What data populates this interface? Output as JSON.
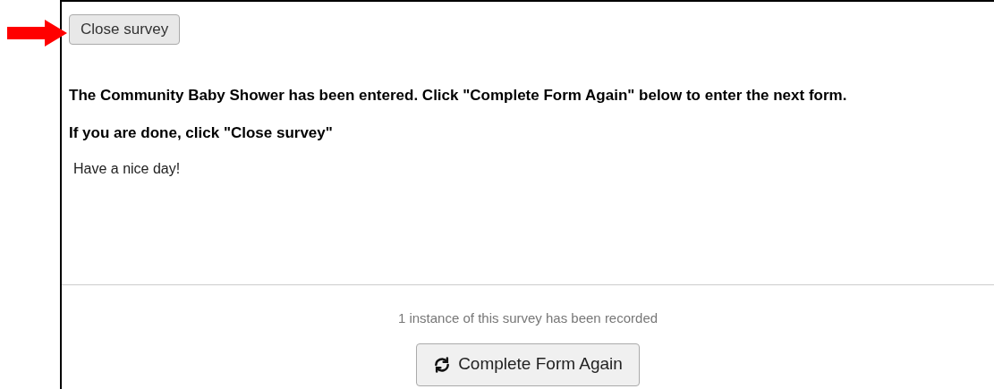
{
  "close_button": {
    "label": "Close survey"
  },
  "messages": [
    "The Community Baby Shower has been entered. Click \"Complete Form Again\" below to enter the next form.",
    "If you are done, click \"Close survey\""
  ],
  "note": "Have a nice day!",
  "footer": {
    "status": "1 instance of this survey has been recorded",
    "button": {
      "label": "Complete Form Again"
    }
  }
}
